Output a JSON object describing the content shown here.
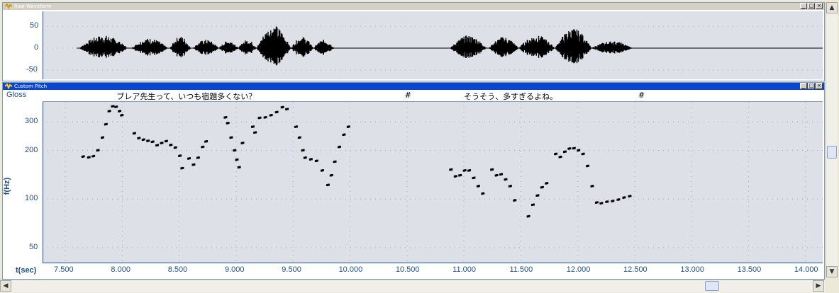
{
  "waveform_pane": {
    "title": "Raw Waveform",
    "y_ticks": [
      {
        "v": 50,
        "label": "50"
      },
      {
        "v": 0,
        "label": "0"
      },
      {
        "v": -50,
        "label": "-50"
      }
    ]
  },
  "pitch_pane": {
    "title": "Custom Pitch",
    "gloss": {
      "label": "Gloss",
      "segments": [
        {
          "text": "ブレア先生って、いつも宿題多くない？",
          "t": 7.95
        },
        {
          "text": "#",
          "t": 10.48
        },
        {
          "text": "そうそう、多すぎるよね。",
          "t": 11.0
        },
        {
          "text": "#",
          "t": 12.53
        }
      ]
    },
    "y_axis_label": "f(Hz)",
    "x_axis_label": "t(sec)"
  },
  "chart_data": {
    "type": "scatter",
    "xlabel": "t(sec)",
    "ylabel": "f(Hz)",
    "xlim": [
      7.3,
      14.15
    ],
    "ylim": [
      40,
      400
    ],
    "yscale": "log",
    "x_ticks": [
      "7.500",
      "8.000",
      "8.500",
      "9.000",
      "9.500",
      "10.000",
      "10.500",
      "11.000",
      "11.500",
      "12.000",
      "12.500",
      "13.000",
      "13.500",
      "14.000"
    ],
    "y_ticks": [
      "300",
      "200",
      "100",
      "50"
    ],
    "grid": true,
    "series": [
      {
        "points": [
          [
            7.65,
            183
          ],
          [
            7.7,
            181
          ],
          [
            7.74,
            184
          ],
          [
            7.78,
            200
          ],
          [
            7.82,
            240
          ],
          [
            7.85,
            290
          ],
          [
            7.88,
            350
          ],
          [
            7.91,
            375
          ],
          [
            7.94,
            372
          ],
          [
            7.97,
            350
          ],
          [
            7.99,
            330
          ],
          [
            8.1,
            255
          ],
          [
            8.14,
            238
          ],
          [
            8.18,
            233
          ],
          [
            8.22,
            229
          ],
          [
            8.26,
            226
          ],
          [
            8.3,
            215
          ],
          [
            8.34,
            222
          ],
          [
            8.38,
            228
          ],
          [
            8.42,
            216
          ],
          [
            8.46,
            208
          ],
          [
            8.5,
            185
          ],
          [
            8.52,
            155
          ],
          [
            8.58,
            178
          ],
          [
            8.62,
            163
          ],
          [
            8.66,
            180
          ],
          [
            8.7,
            210
          ],
          [
            8.73,
            227
          ],
          [
            8.9,
            320
          ],
          [
            8.92,
            295
          ],
          [
            8.95,
            240
          ],
          [
            8.98,
            200
          ],
          [
            9.0,
            175
          ],
          [
            9.02,
            157
          ],
          [
            9.05,
            222
          ],
          [
            9.14,
            280
          ],
          [
            9.16,
            258
          ],
          [
            9.2,
            318
          ],
          [
            9.25,
            320
          ],
          [
            9.3,
            330
          ],
          [
            9.35,
            345
          ],
          [
            9.4,
            370
          ],
          [
            9.44,
            360
          ],
          [
            9.52,
            280
          ],
          [
            9.55,
            240
          ],
          [
            9.58,
            200
          ],
          [
            9.6,
            180
          ],
          [
            9.65,
            176
          ],
          [
            9.7,
            172
          ],
          [
            9.75,
            150
          ],
          [
            9.8,
            122
          ],
          [
            9.83,
            140
          ],
          [
            9.86,
            170
          ],
          [
            9.9,
            210
          ],
          [
            9.94,
            250
          ],
          [
            9.98,
            280
          ],
          [
            10.88,
            152
          ],
          [
            10.92,
            138
          ],
          [
            10.96,
            140
          ],
          [
            11.0,
            150
          ],
          [
            11.04,
            150
          ],
          [
            11.08,
            135
          ],
          [
            11.12,
            120
          ],
          [
            11.16,
            108
          ],
          [
            11.24,
            152
          ],
          [
            11.28,
            140
          ],
          [
            11.32,
            142
          ],
          [
            11.36,
            132
          ],
          [
            11.4,
            120
          ],
          [
            11.44,
            98
          ],
          [
            11.56,
            78
          ],
          [
            11.6,
            92
          ],
          [
            11.64,
            105
          ],
          [
            11.68,
            118
          ],
          [
            11.72,
            125
          ],
          [
            11.8,
            190
          ],
          [
            11.84,
            182
          ],
          [
            11.88,
            196
          ],
          [
            11.92,
            205
          ],
          [
            11.96,
            206
          ],
          [
            12.0,
            200
          ],
          [
            12.04,
            190
          ],
          [
            12.08,
            160
          ],
          [
            12.12,
            120
          ],
          [
            12.16,
            95
          ],
          [
            12.2,
            94
          ],
          [
            12.25,
            96
          ],
          [
            12.3,
            97
          ],
          [
            12.35,
            99
          ],
          [
            12.4,
            102
          ],
          [
            12.45,
            104
          ]
        ]
      }
    ]
  }
}
